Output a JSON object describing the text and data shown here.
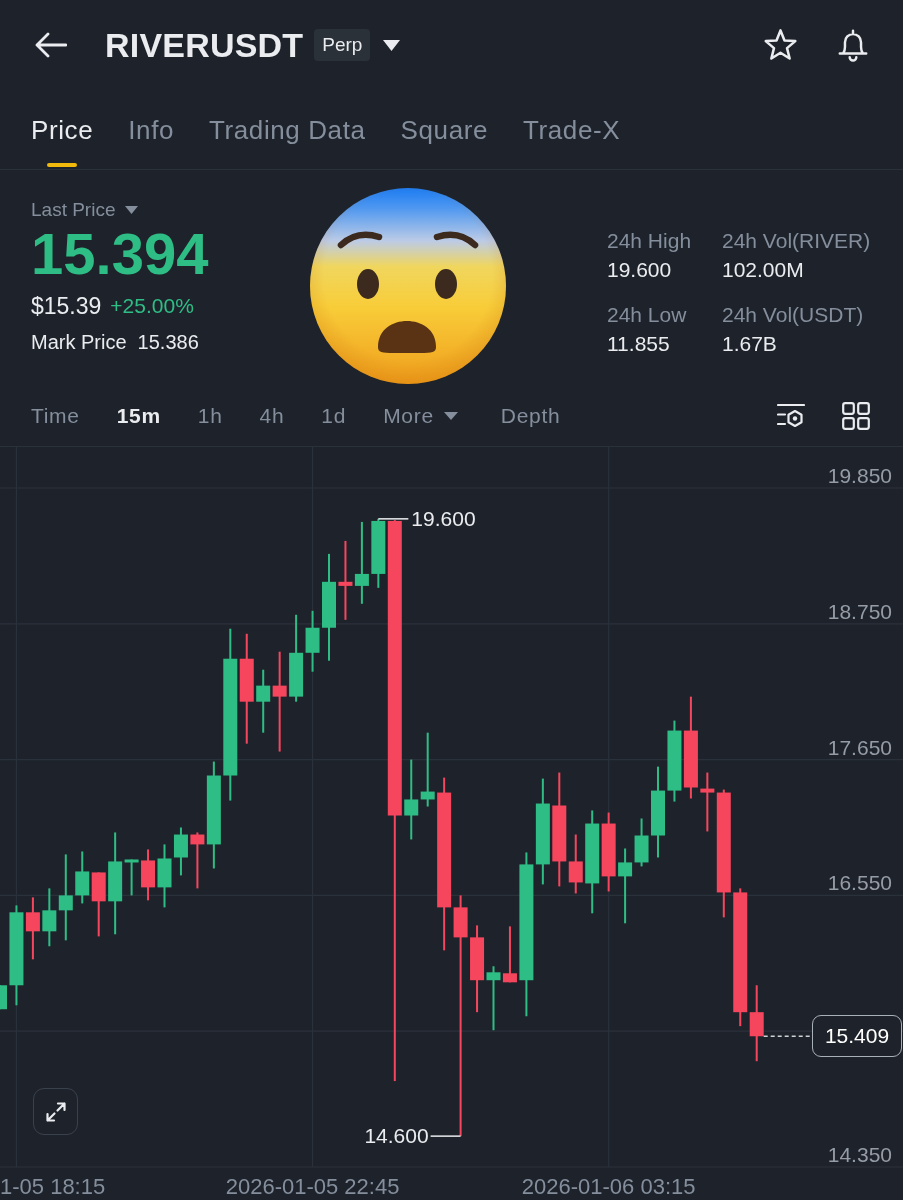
{
  "header": {
    "symbol": "RIVERUSDT",
    "badge": "Perp"
  },
  "tabs": [
    {
      "label": "Price",
      "selected": true
    },
    {
      "label": "Info",
      "selected": false
    },
    {
      "label": "Trading Data",
      "selected": false
    },
    {
      "label": "Square",
      "selected": false
    },
    {
      "label": "Trade-X",
      "selected": false
    }
  ],
  "summary": {
    "last_price_label": "Last Price",
    "last_price": "15.394",
    "usd_price": "$15.39",
    "change": "+25.00%",
    "mark_price_label": "Mark Price",
    "mark_price": "15.386"
  },
  "stats": [
    {
      "label": "24h High",
      "value": "19.600"
    },
    {
      "label": "24h Vol(RIVER)",
      "value": "102.00M"
    },
    {
      "label": "24h Low",
      "value": "11.855"
    },
    {
      "label": "24h Vol(USDT)",
      "value": "1.67B"
    }
  ],
  "intervals": [
    {
      "label": "Time",
      "kind": "option",
      "selected": false
    },
    {
      "label": "15m",
      "kind": "option",
      "selected": true
    },
    {
      "label": "1h",
      "kind": "option",
      "selected": false
    },
    {
      "label": "4h",
      "kind": "option",
      "selected": false
    },
    {
      "label": "1d",
      "kind": "option",
      "selected": false
    },
    {
      "label": "More",
      "kind": "dropdown",
      "selected": false
    },
    {
      "label": "Depth",
      "kind": "option",
      "selected": false
    }
  ],
  "chart": {
    "edge_time_label": "1-05 18:15",
    "chart_data": {
      "type": "candlestick",
      "grid": true,
      "categories": [
        null,
        null,
        null,
        null,
        null,
        null,
        null,
        null,
        null,
        null,
        null,
        null,
        null,
        null,
        null,
        null,
        null,
        null,
        null,
        "2026-01-05 22:45",
        null,
        null,
        null,
        null,
        null,
        null,
        null,
        null,
        null,
        null,
        null,
        null,
        null,
        null,
        null,
        null,
        null,
        "2026-01-06 03:15",
        null,
        null,
        null,
        null,
        null,
        null,
        null,
        null,
        null
      ],
      "ohlc": [
        [
          15.628,
          15.822,
          15.628,
          15.822
        ],
        [
          15.822,
          16.469,
          15.66,
          16.413
        ],
        [
          16.413,
          16.534,
          16.032,
          16.259
        ],
        [
          16.259,
          16.607,
          16.138,
          16.429
        ],
        [
          16.429,
          16.882,
          16.186,
          16.55
        ],
        [
          16.55,
          16.906,
          16.485,
          16.744
        ],
        [
          16.736,
          16.736,
          16.218,
          16.502
        ],
        [
          16.502,
          17.06,
          16.235,
          16.825
        ],
        [
          16.825,
          16.841,
          16.55,
          16.841
        ],
        [
          16.833,
          16.922,
          16.51,
          16.615
        ],
        [
          16.615,
          16.963,
          16.453,
          16.849
        ],
        [
          16.857,
          17.1,
          16.712,
          17.043
        ],
        [
          17.043,
          17.06,
          16.607,
          16.963
        ],
        [
          16.963,
          17.634,
          16.768,
          17.521
        ],
        [
          17.521,
          18.71,
          17.318,
          18.467
        ],
        [
          18.467,
          18.669,
          17.779,
          18.119
        ],
        [
          18.119,
          18.378,
          17.868,
          18.249
        ],
        [
          18.249,
          18.524,
          17.715,
          18.16
        ],
        [
          18.16,
          18.823,
          18.119,
          18.515
        ],
        [
          18.515,
          18.855,
          18.362,
          18.718
        ],
        [
          18.718,
          19.316,
          18.451,
          19.09
        ],
        [
          19.09,
          19.421,
          18.782,
          19.057
        ],
        [
          19.057,
          19.575,
          18.912,
          19.154
        ],
        [
          19.154,
          19.6,
          19.041,
          19.583
        ],
        [
          19.583,
          19.59,
          15.046,
          17.197
        ],
        [
          17.197,
          17.65,
          17.003,
          17.327
        ],
        [
          17.327,
          17.868,
          17.27,
          17.391
        ],
        [
          17.383,
          17.504,
          16.105,
          16.453
        ],
        [
          16.453,
          16.55,
          14.6,
          16.21
        ],
        [
          16.21,
          16.307,
          15.604,
          15.863
        ],
        [
          15.863,
          15.976,
          15.458,
          15.927
        ],
        [
          15.919,
          16.299,
          15.846,
          15.846
        ],
        [
          15.863,
          16.898,
          15.571,
          16.801
        ],
        [
          16.801,
          17.496,
          16.639,
          17.294
        ],
        [
          17.278,
          17.545,
          16.623,
          16.825
        ],
        [
          16.825,
          17.043,
          16.566,
          16.655
        ],
        [
          16.647,
          17.238,
          16.405,
          17.132
        ],
        [
          17.132,
          17.221,
          16.582,
          16.704
        ],
        [
          16.704,
          16.93,
          16.324,
          16.817
        ],
        [
          16.817,
          17.173,
          16.785,
          17.035
        ],
        [
          17.035,
          17.593,
          16.857,
          17.399
        ],
        [
          17.399,
          17.966,
          17.31,
          17.885
        ],
        [
          17.885,
          18.16,
          17.335,
          17.424
        ],
        [
          17.415,
          17.545,
          17.068,
          17.383
        ],
        [
          17.383,
          17.407,
          16.372,
          16.574
        ],
        [
          16.574,
          16.607,
          15.491,
          15.604
        ],
        [
          15.604,
          15.822,
          15.207,
          15.409
        ]
      ],
      "ylim": [
        14.35,
        20.182
      ],
      "yticks": [
        {
          "value": 19.85,
          "label": "19.850"
        },
        {
          "value": 18.75,
          "label": "18.750"
        },
        {
          "value": 17.65,
          "label": "17.650"
        },
        {
          "value": 16.55,
          "label": "16.550"
        },
        {
          "value": 14.35,
          "label": "14.350"
        }
      ],
      "annotations": [
        "19.600",
        "14.600",
        "15.409"
      ]
    }
  }
}
